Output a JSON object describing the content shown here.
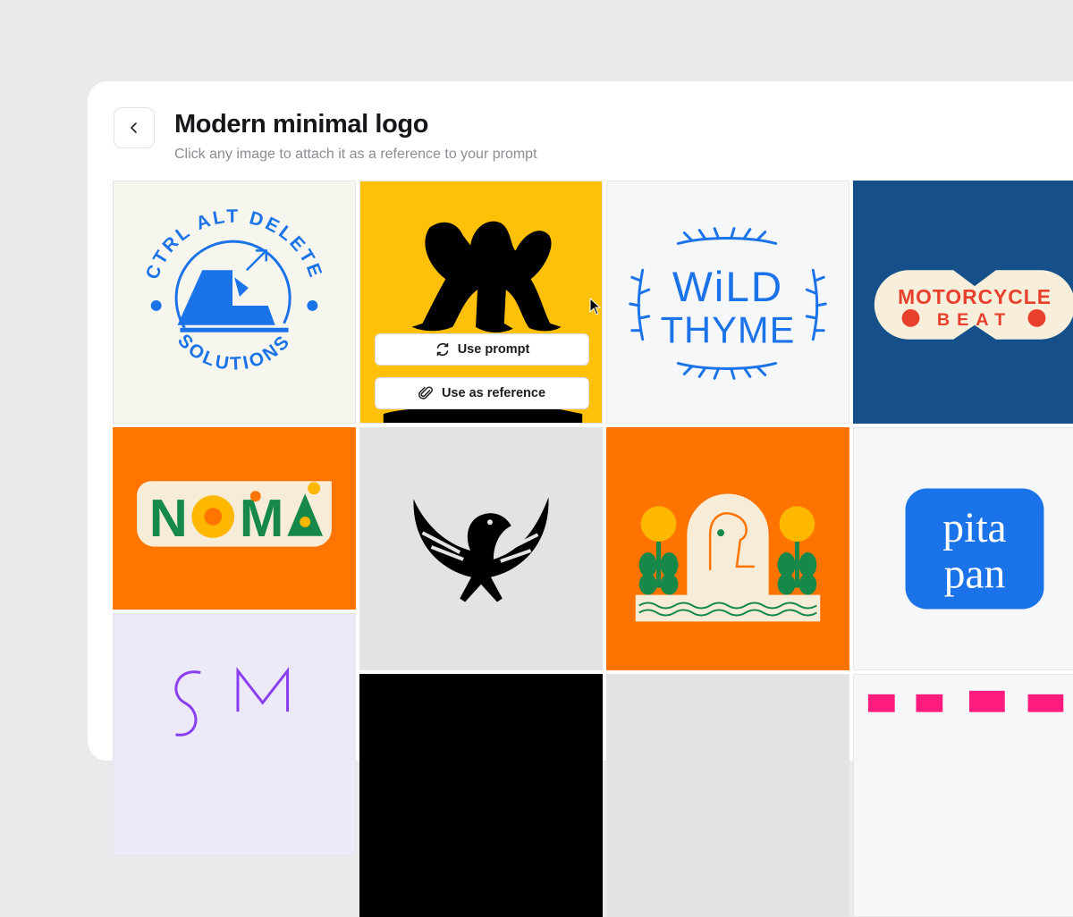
{
  "header": {
    "title": "Modern minimal logo",
    "subtitle": "Click any image to attach it as a reference to your prompt"
  },
  "overlay": {
    "use_prompt_label": "Use prompt",
    "use_reference_label": "Use as reference"
  },
  "tiles": [
    {
      "name": "ctrl-alt-delete",
      "bg": "#f7f6ee",
      "top": "CTRL ALT DELETE",
      "bottom": "SOLUTIONS"
    },
    {
      "name": "figure-silhouette",
      "bg": "#ffc107"
    },
    {
      "name": "wild-thyme",
      "bg": "#f6f7f8",
      "line1": "WiLD",
      "line2": "THYME"
    },
    {
      "name": "motorcycle-beat",
      "bg": "#15508a",
      "line1": "MOTORCYCLE",
      "line2": "BEAT"
    },
    {
      "name": "noma",
      "bg": "#ff7500",
      "letters": [
        "N",
        "O",
        "M",
        "A"
      ]
    },
    {
      "name": "phoenix",
      "bg": "#e3e3e3"
    },
    {
      "name": "flowers-dog",
      "bg": "#ff7300"
    },
    {
      "name": "pita-pan",
      "bg": "#f6f7f8",
      "line1": "pita",
      "line2": "pan"
    },
    {
      "name": "lavender-monogram",
      "bg": "#ece9f8"
    },
    {
      "name": "black-tile",
      "bg": "#000000"
    },
    {
      "name": "grey-tile",
      "bg": "#e3e3e3"
    },
    {
      "name": "pink-tile",
      "bg": "#f6f7f8"
    }
  ],
  "colors": {
    "blue": "#1a73e8",
    "orange": "#ff7500",
    "red": "#e8402c",
    "green": "#15884a"
  }
}
